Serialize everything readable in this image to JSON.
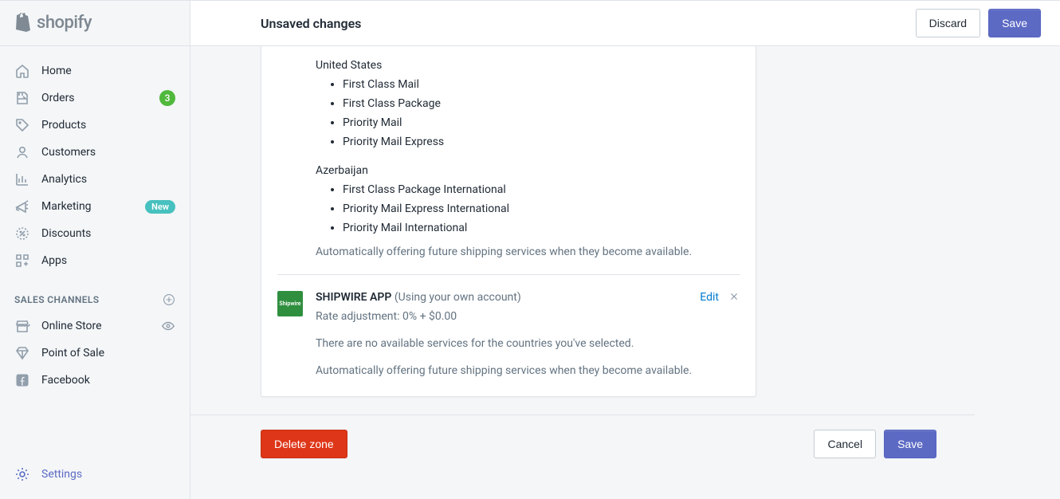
{
  "brand": {
    "name": "shopify"
  },
  "topbar": {
    "title": "Unsaved changes",
    "discard": "Discard",
    "save": "Save"
  },
  "nav": {
    "items": [
      {
        "label": "Home"
      },
      {
        "label": "Orders",
        "badge_count": "3"
      },
      {
        "label": "Products"
      },
      {
        "label": "Customers"
      },
      {
        "label": "Analytics"
      },
      {
        "label": "Marketing",
        "badge_new": "New"
      },
      {
        "label": "Discounts"
      },
      {
        "label": "Apps"
      }
    ]
  },
  "channels": {
    "header": "SALES CHANNELS",
    "items": [
      {
        "label": "Online Store"
      },
      {
        "label": "Point of Sale"
      },
      {
        "label": "Facebook"
      }
    ]
  },
  "settings": {
    "label": "Settings"
  },
  "rates": {
    "countries": [
      {
        "name": "United States",
        "services": [
          "First Class Mail",
          "First Class Package",
          "Priority Mail",
          "Priority Mail Express"
        ]
      },
      {
        "name": "Azerbaijan",
        "services": [
          "First Class Package International",
          "Priority Mail Express International",
          "Priority Mail International"
        ]
      }
    ],
    "auto_note": "Automatically offering future shipping services when they become available."
  },
  "carrier": {
    "logo_text": "Shipwire",
    "name": "SHIPWIRE APP",
    "account": "(Using your own account)",
    "edit": "Edit",
    "rate_adj": "Rate adjustment: 0% + $0.00",
    "no_services": "There are no available services for the countries you've selected.",
    "auto_note": "Automatically offering future shipping services when they become available."
  },
  "footer": {
    "delete": "Delete zone",
    "cancel": "Cancel",
    "save": "Save"
  }
}
